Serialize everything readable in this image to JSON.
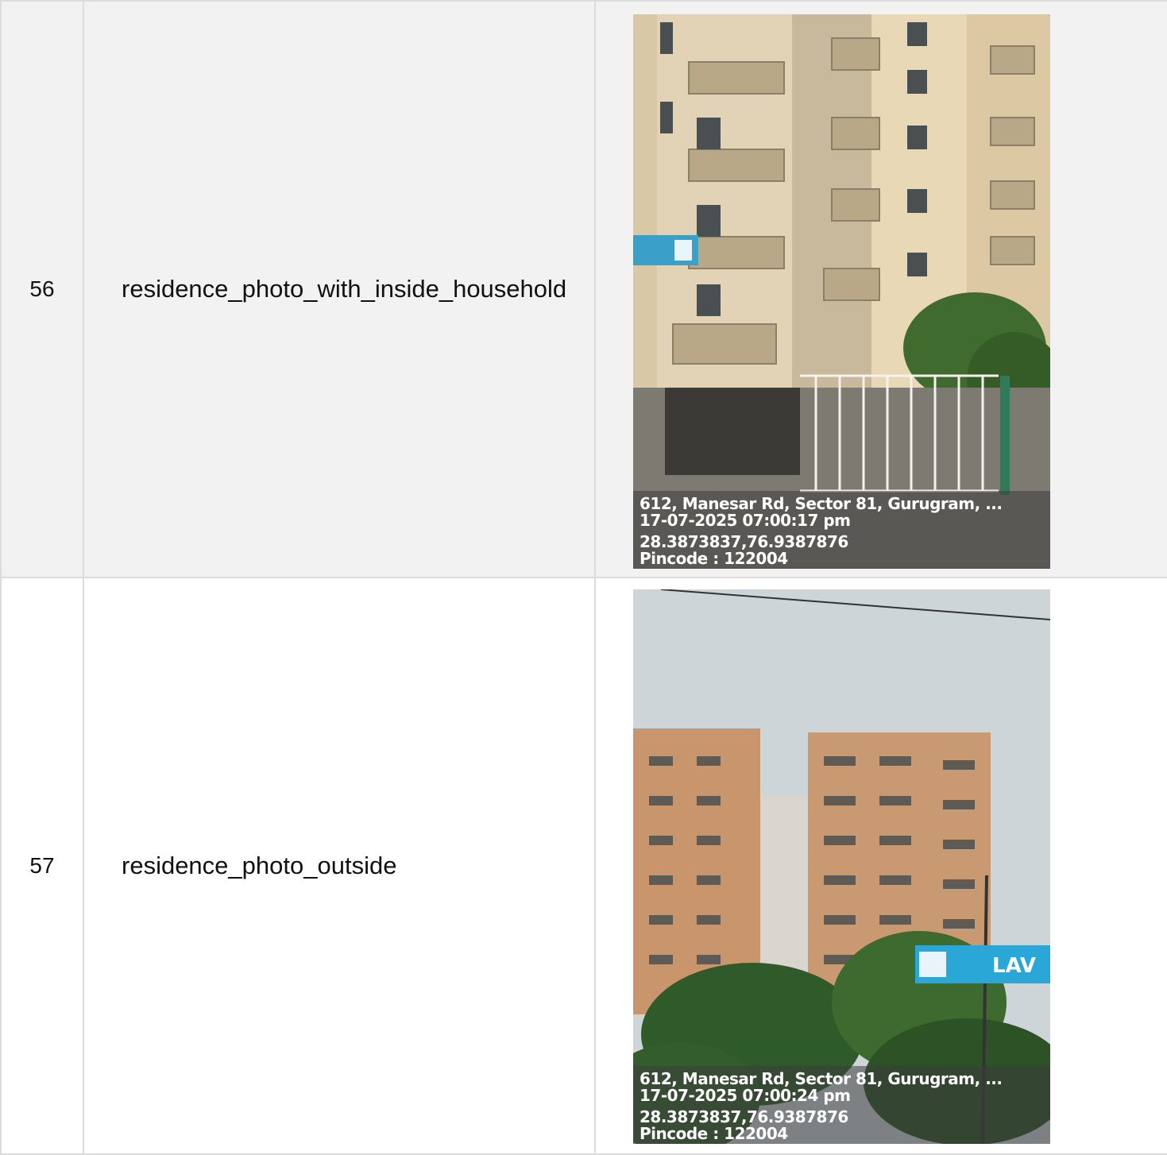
{
  "rows": [
    {
      "number": "56",
      "label": "residence_photo_with_inside_household",
      "photo": {
        "address": "612, Manesar Rd, Sector 81, Gurugram, ...",
        "datetime": "17-07-2025 07:00:17 pm",
        "coordinates": "28.3873837,76.9387876",
        "pincode": "Pincode : 122004"
      }
    },
    {
      "number": "57",
      "label": "residence_photo_outside",
      "photo": {
        "address": "612, Manesar Rd, Sector 81, Gurugram, ...",
        "datetime": "17-07-2025 07:00:24 pm",
        "coordinates": "28.3873837,76.9387876",
        "pincode": "Pincode : 122004",
        "signage_text": "LAV"
      }
    }
  ]
}
